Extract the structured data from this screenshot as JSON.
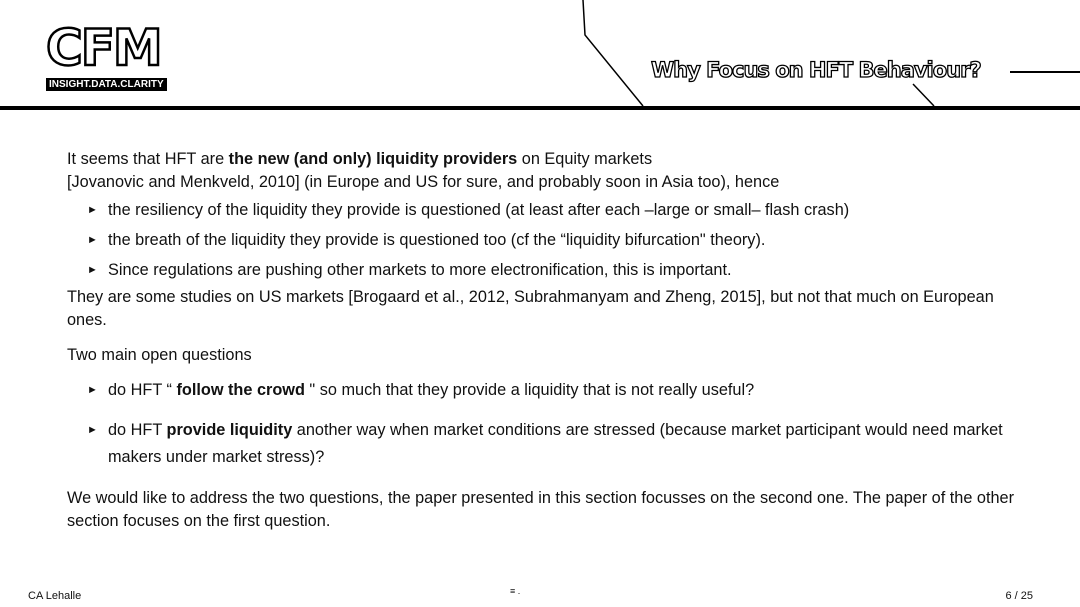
{
  "header": {
    "logo_text": "CFM",
    "logo_tagline": "INSIGHT.DATA.CLARITY",
    "title": "Why Focus on HFT Behaviour?"
  },
  "body": {
    "intro": {
      "pre": "It seems that HFT are ",
      "bold": "the new (and only) liquidity providers",
      "post": " on Equity markets",
      "line2": "[Jovanovic and Menkveld, 2010] (in Europe and US for sure, and probably soon in Asia too), hence"
    },
    "bullets1": [
      "the resiliency of the liquidity they provide is questioned (at least after each –large or small– flash crash)",
      "the breath of the liquidity they provide is questioned too (cf the “liquidity bifurcation\" theory).",
      "Since regulations are pushing other markets to more electronification, this is important."
    ],
    "studies": "They are some studies on US markets [Brogaard et al., 2012, Subrahmanyam and Zheng, 2015], but not that much on European ones.",
    "questions_heading": "Two main open questions",
    "q1": {
      "pre": "do HFT “ ",
      "bold": "follow the crowd",
      "post": " \" so much that they provide a liquidity that is not really useful?"
    },
    "q2": {
      "pre": "do HFT  ",
      "bold": "provide liquidity",
      "post": "  another way when market conditions are stressed (because market participant would need market makers under market stress)?"
    },
    "conclusion": "We would like to address the two questions, the paper presented in this section focusses on the second one. The paper of the other section focuses on the first question.",
    "bullet_glyph": "►"
  },
  "footer": {
    "author": "CA Lehalle",
    "page": "6 / 25"
  }
}
